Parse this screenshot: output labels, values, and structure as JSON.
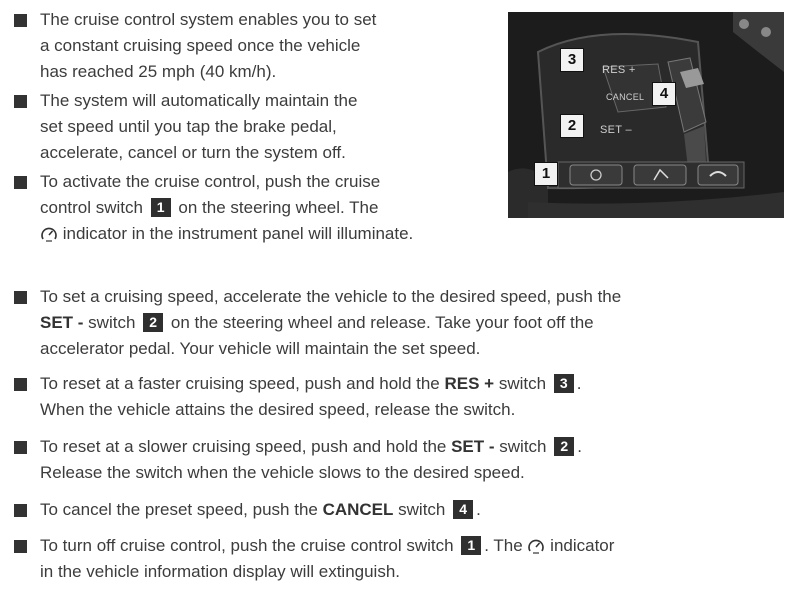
{
  "bullets": [
    {
      "lines": [
        [
          {
            "t": "The cruise control system enables you to set"
          }
        ],
        [
          {
            "t": "a constant cruising speed once the vehicle"
          }
        ],
        [
          {
            "t": "has reached 25 mph (40 km/h)."
          }
        ]
      ]
    },
    {
      "lines": [
        [
          {
            "t": "The system will automatically maintain the"
          }
        ],
        [
          {
            "t": "set speed until you tap the brake pedal,"
          }
        ],
        [
          {
            "t": "accelerate, cancel or turn the system off."
          }
        ]
      ]
    },
    {
      "lines": [
        [
          {
            "t": "To activate the cruise control, push the cruise"
          }
        ],
        [
          {
            "t": "control switch "
          },
          {
            "n": "1"
          },
          {
            "t": " on the steering wheel. The"
          }
        ],
        [
          {
            "i": "cruise-indicator-icon"
          },
          {
            "t": " indicator in the instrument panel will illuminate."
          }
        ]
      ]
    },
    {
      "lines": [
        [
          {
            "t": "To set a cruising speed, accelerate the vehicle to the desired speed, push the"
          }
        ],
        [
          {
            "b": "SET -"
          },
          {
            "t": " switch "
          },
          {
            "n": "2"
          },
          {
            "t": " on the steering wheel and release. Take your foot off the"
          }
        ],
        [
          {
            "t": "accelerator pedal. Your vehicle will maintain the set speed."
          }
        ]
      ]
    },
    {
      "lines": [
        [
          {
            "t": "To reset at a faster cruising speed, push and hold the "
          },
          {
            "b": "RES +"
          },
          {
            "t": " switch "
          },
          {
            "n": "3"
          },
          {
            "t": "."
          }
        ],
        [
          {
            "t": "When the vehicle attains the desired speed, release the switch."
          }
        ]
      ]
    },
    {
      "lines": [
        [
          {
            "t": "To reset at a slower cruising speed, push and hold the "
          },
          {
            "b": "SET -"
          },
          {
            "t": " switch "
          },
          {
            "n": "2"
          },
          {
            "t": "."
          }
        ],
        [
          {
            "t": "Release the switch when the vehicle slows to the desired speed."
          }
        ]
      ]
    },
    {
      "lines": [
        [
          {
            "t": "To cancel the preset speed, push the "
          },
          {
            "b": "CANCEL"
          },
          {
            "t": " switch "
          },
          {
            "n": "4"
          },
          {
            "t": "."
          }
        ]
      ]
    },
    {
      "lines": [
        [
          {
            "t": "To turn off cruise control, push the cruise control switch "
          },
          {
            "n": "1"
          },
          {
            "t": ". The "
          },
          {
            "i": "cruise-indicator-icon"
          },
          {
            "t": " indicator"
          }
        ],
        [
          {
            "t": "in the vehicle information display will extinguish."
          }
        ]
      ]
    }
  ],
  "photo": {
    "labels": {
      "res": "RES +",
      "cancel": "CANCEL",
      "set": "SET –"
    },
    "callouts": {
      "one": "1",
      "two": "2",
      "three": "3",
      "four": "4"
    }
  }
}
